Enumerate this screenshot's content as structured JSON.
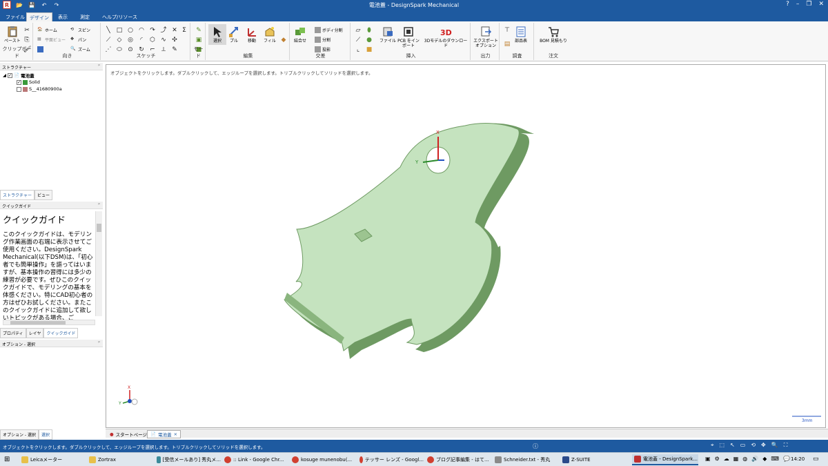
{
  "window": {
    "title": "電池蓋 - DesignSpark Mechanical",
    "minimize": "–",
    "restore": "❐",
    "close": "✕",
    "help": "?"
  },
  "quick_access": {
    "logo": "R"
  },
  "tabs": [
    "ファイル",
    "デザイン",
    "表示",
    "測定",
    "ヘルプ/リソース"
  ],
  "ribbon": {
    "clipboard": {
      "label": "クリップボード",
      "paste": "ペースト"
    },
    "orient": {
      "label": "向き",
      "home": "ホーム",
      "plane": "平面ビュー",
      "spin": "スピン",
      "pan": "パン",
      "zoom": "ズーム"
    },
    "sketch": {
      "label": "スケッチ"
    },
    "mode": {
      "label": "モード"
    },
    "edit": {
      "label": "編集",
      "select": "選択",
      "pull": "プル",
      "move": "移動",
      "fill": "フィル"
    },
    "intersect": {
      "label": "交差",
      "combine": "結合せ",
      "split_body": "ボディ分割",
      "split": "分割",
      "project": "投影"
    },
    "insert": {
      "label": "挿入",
      "file": "ファイル",
      "pcb": "PCB をインポート",
      "model3d": "3Dモデルのダウンロード"
    },
    "output": {
      "label": "出力",
      "export": "エクスポートオプション"
    },
    "investigate": {
      "label": "調査",
      "parts": "部品表"
    },
    "order": {
      "label": "注文",
      "bom": "BOM 見積もり"
    }
  },
  "structure": {
    "header": "ストラクチャー",
    "root": "電池蓋",
    "items": [
      "Solid",
      "S__41680900a"
    ]
  },
  "panel_tabs_1": [
    "ストラクチャー",
    "ビュー"
  ],
  "quick_guide": {
    "header": "クイックガイド",
    "title": "クイックガイド",
    "body": "このクイックガイドは、モデリング作業画面の右端に表示させてご使用ください。DesignSpark Mechanical(以下DSM)は、「初心者でも簡単操作」を謳ってはいますが、基本操作の習得には多少の練習が必要です。ぜひこのクイックガイドで、モデリングの基本を体感ください。特にCAD初心者の方はぜひお試しください。またこのクイックガイドに追加して欲しいトピックがある場合、ご"
  },
  "panel_tabs_2": [
    "プロパティ",
    "レイヤ",
    "クイックガイド"
  ],
  "options_header": "オプション - 選択",
  "bottom_left_tabs": [
    "オプション - 選択",
    "選択"
  ],
  "viewport": {
    "hint": "オブジェクトをクリックします。ダブルクリックして、エッジループを選択します。トリプルクリックしてソリッドを選択します。",
    "scale": "3mm",
    "axis_x": "X",
    "axis_y": "Y",
    "part_color": "#c5e3bf"
  },
  "doc_tabs": [
    "スタートページ",
    "電池蓋"
  ],
  "doc_tab_close": "×",
  "status": {
    "message": "オブジェクトをクリックします。ダブルクリックして、エッジループを選択します。トリプルクリックしてソリッドを選択します。"
  },
  "taskbar": {
    "items": [
      "Leicaメーター",
      "Zortrax",
      "[受信メールあり] 秀丸メ...",
      ":: Link - Google Chr...",
      "kosuge munenobu(...",
      "テッサー レンズ - Googl...",
      "ブログ記事編集 - はて...",
      "Schneider.txt - 秀丸",
      "Z-SUITE",
      "電池蓋 - DesignSpark..."
    ],
    "time": "14:20"
  }
}
